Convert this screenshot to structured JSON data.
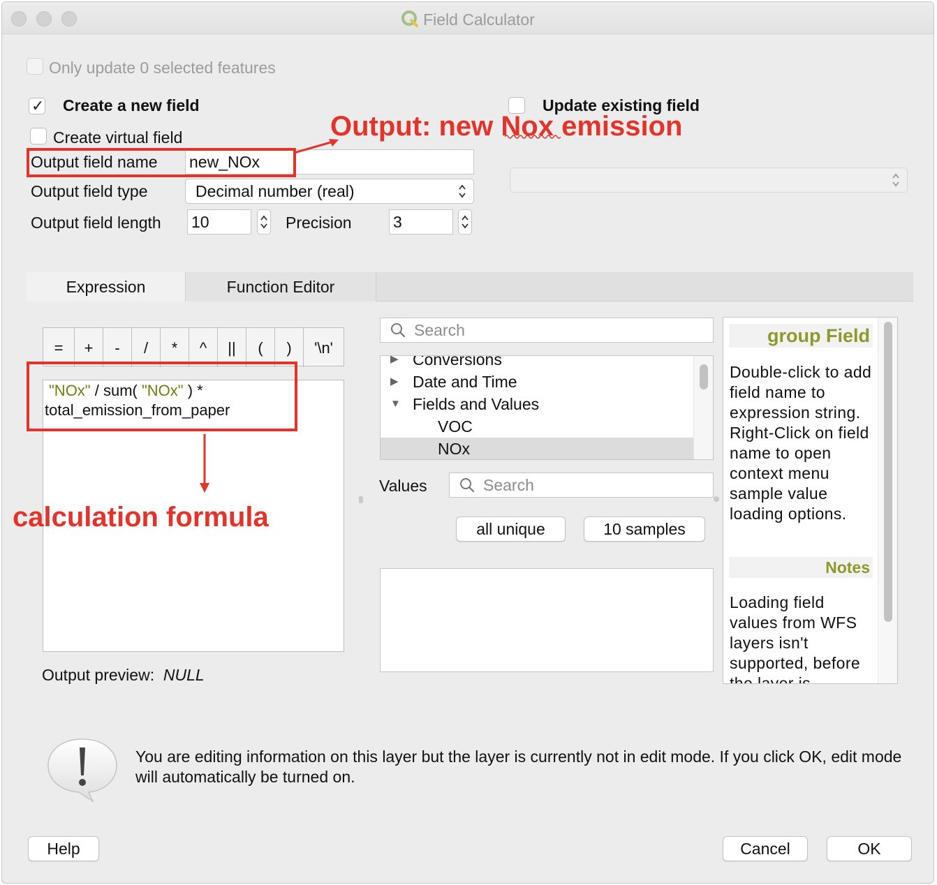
{
  "window": {
    "title": "Field Calculator"
  },
  "only_update": {
    "label": "Only update 0 selected features",
    "checked": false,
    "enabled": false
  },
  "create_new_field": {
    "label": "Create a new field",
    "checked": true
  },
  "update_existing_field": {
    "label": "Update existing field",
    "checked": false
  },
  "create_virtual_field": {
    "label": "Create virtual field",
    "checked": false
  },
  "output_field_name": {
    "label": "Output field name",
    "value": "new_NOx"
  },
  "output_field_type": {
    "label": "Output field type",
    "value": "Decimal number (real)"
  },
  "output_field_length": {
    "label": "Output field length",
    "value": "10"
  },
  "precision": {
    "label": "Precision",
    "value": "3"
  },
  "annotations": {
    "output_note": "Output: new Nox emission",
    "formula_note": "calculation formula",
    "color": "#e2342a"
  },
  "tabs": [
    {
      "label": "Expression",
      "active": true
    },
    {
      "label": "Function Editor",
      "active": false
    }
  ],
  "operators": [
    "=",
    "+",
    "-",
    "/",
    "*",
    "^",
    "||",
    "(",
    ")",
    "'\\n'"
  ],
  "expression": {
    "line1_part1": "\"NOx\"",
    "line1_part2": " / sum( ",
    "line1_part3": "\"NOx\"",
    "line1_part4": " ) *",
    "line2": "total_emission_from_paper"
  },
  "output_preview": {
    "label": "Output preview:",
    "value": "NULL"
  },
  "function_search": {
    "placeholder": "Search"
  },
  "function_tree": [
    {
      "label": "Conversions",
      "expanded": false,
      "level": 0
    },
    {
      "label": "Date and Time",
      "expanded": false,
      "level": 0
    },
    {
      "label": "Fields and Values",
      "expanded": true,
      "level": 0
    },
    {
      "label": "VOC",
      "level": 1
    },
    {
      "label": "NOx",
      "level": 1,
      "selected": true
    }
  ],
  "values": {
    "label": "Values",
    "search_placeholder": "Search",
    "all_unique_label": "all unique",
    "samples_label": "10 samples"
  },
  "help_panel": {
    "heading": "group Field",
    "body": "Double-click to add field name to expression string. Right-Click on field name to open context menu sample value loading options.",
    "notes_heading": "Notes",
    "notes_body": "Loading field values from WFS layers isn't supported, before the layer is"
  },
  "warning": {
    "icon": "exclamation-icon",
    "text": "You are editing information on this layer but the layer is currently not in edit mode. If you click OK, edit mode will automatically be turned on."
  },
  "buttons": {
    "help": "Help",
    "cancel": "Cancel",
    "ok": "OK"
  },
  "colors": {
    "qgis_green": "#589632",
    "olive_field": "#7a7a12",
    "help_heading": "#8d9a2a"
  }
}
